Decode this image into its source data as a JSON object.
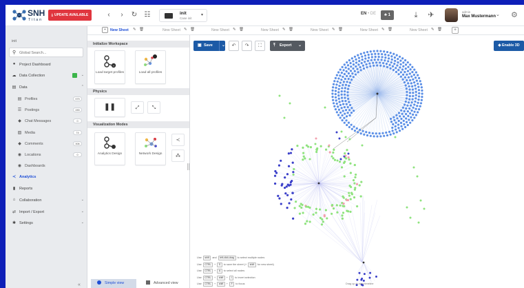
{
  "app": {
    "logo_name": "SNH",
    "logo_sub": "Titan",
    "update_label": "UPDATE AVAILABLE",
    "case": {
      "title": "init",
      "subtitle": "Case init"
    },
    "lang_active": "EN",
    "lang_sep": "•",
    "lang_alt": "DE",
    "notifications": "1",
    "user_role": "admin",
    "user_name": "Max Mustermann"
  },
  "icons": {
    "back": "chevron-left-icon",
    "forward": "chevron-right-icon",
    "refresh": "refresh-icon",
    "menu": "list-icon",
    "download": "download-icon",
    "rocket": "rocket-icon",
    "settings": "gear-icon"
  },
  "sidebar": {
    "case_label": "init",
    "search_placeholder": "Global Search...",
    "items": [
      {
        "label": "Project Dashboard",
        "icon": "●",
        "level": 0
      },
      {
        "label": "Data Collection",
        "icon": "☁",
        "level": 0,
        "green": true,
        "caret": "⌄"
      },
      {
        "label": "Data",
        "icon": "▤",
        "level": 0,
        "caret": "⌃"
      },
      {
        "label": "Profiles",
        "icon": "▤",
        "level": 1,
        "badge": "979"
      },
      {
        "label": "Postings",
        "icon": "☰",
        "level": 1,
        "badge": "283"
      },
      {
        "label": "Chat Messages",
        "icon": "◆",
        "level": 1,
        "badge": "0"
      },
      {
        "label": "Media",
        "icon": "▨",
        "level": 1,
        "badge": "74"
      },
      {
        "label": "Comments",
        "icon": "◆",
        "level": 1,
        "badge": "306"
      },
      {
        "label": "Locations",
        "icon": "◉",
        "level": 1,
        "badge": "0"
      },
      {
        "label": "Dashboards",
        "icon": "◉",
        "level": 1
      },
      {
        "label": "Analytics",
        "icon": "≺",
        "level": 0,
        "active": true
      },
      {
        "label": "Reports",
        "icon": "▮",
        "level": 0
      },
      {
        "label": "Collaboration",
        "icon": "⌂",
        "level": 0,
        "caret": "⌄"
      },
      {
        "label": "Import / Export",
        "icon": "⇄",
        "level": 0,
        "caret": "⌄"
      },
      {
        "label": "Settings",
        "icon": "✱",
        "level": 0,
        "caret": "⌄"
      }
    ]
  },
  "sheets": {
    "tabs": [
      {
        "label": "New Sheet",
        "active": true
      },
      {
        "label": "New Sheet"
      },
      {
        "label": "New Sheet"
      },
      {
        "label": "New Sheet"
      },
      {
        "label": "New Sheet"
      },
      {
        "label": "New Sheet"
      },
      {
        "label": "New Sheet"
      }
    ],
    "add_label": "+"
  },
  "panel": {
    "initialize_title": "Initialize Workspace",
    "load_target": "Load target profiles",
    "load_all": "Load all profiles",
    "physics_title": "Physics",
    "visualization_title": "Visualization Modes",
    "analytics_design": "Analytics Design",
    "network_design": "Network Design",
    "simple_view": "Simple view",
    "advanced_view": "Advanced view"
  },
  "canvas": {
    "save_label": "Save",
    "export_label": "Export",
    "enable3d_label": "Enable 3D",
    "timeline_hint": "Drag up to view timeline",
    "hints": [
      {
        "pre": "Use",
        "keys": [
          "shift"
        ],
        "mid": "and",
        "keys2": [
          "left-click-drag"
        ],
        "post": "to select multiple nodes"
      },
      {
        "pre": "Use",
        "keys": [
          "CTRL",
          "S"
        ],
        "mid": "to save the sheet (+",
        "keys2": [
          "shift"
        ],
        "post": "for new sheet)"
      },
      {
        "pre": "Use",
        "keys": [
          "CTRL",
          "A"
        ],
        "mid": "to select all nodes",
        "keys2": [],
        "post": ""
      },
      {
        "pre": "Use",
        "keys": [
          "CTRL",
          "shift",
          "I"
        ],
        "mid": "to invert selection",
        "keys2": [],
        "post": ""
      },
      {
        "pre": "Use",
        "keys": [
          "CTRL",
          "shift",
          "F"
        ],
        "mid": "to focus",
        "keys2": [],
        "post": ""
      }
    ]
  },
  "colors": {
    "accent": "#1f4fd6",
    "primary_button": "#1c5aa6",
    "update_red": "#e0353e",
    "node_blue": "#5b8fe6",
    "node_navy": "#3a3fc9",
    "node_green": "#8fe37e",
    "node_pink": "#f2a0ae",
    "background": "#0e1fb8"
  }
}
